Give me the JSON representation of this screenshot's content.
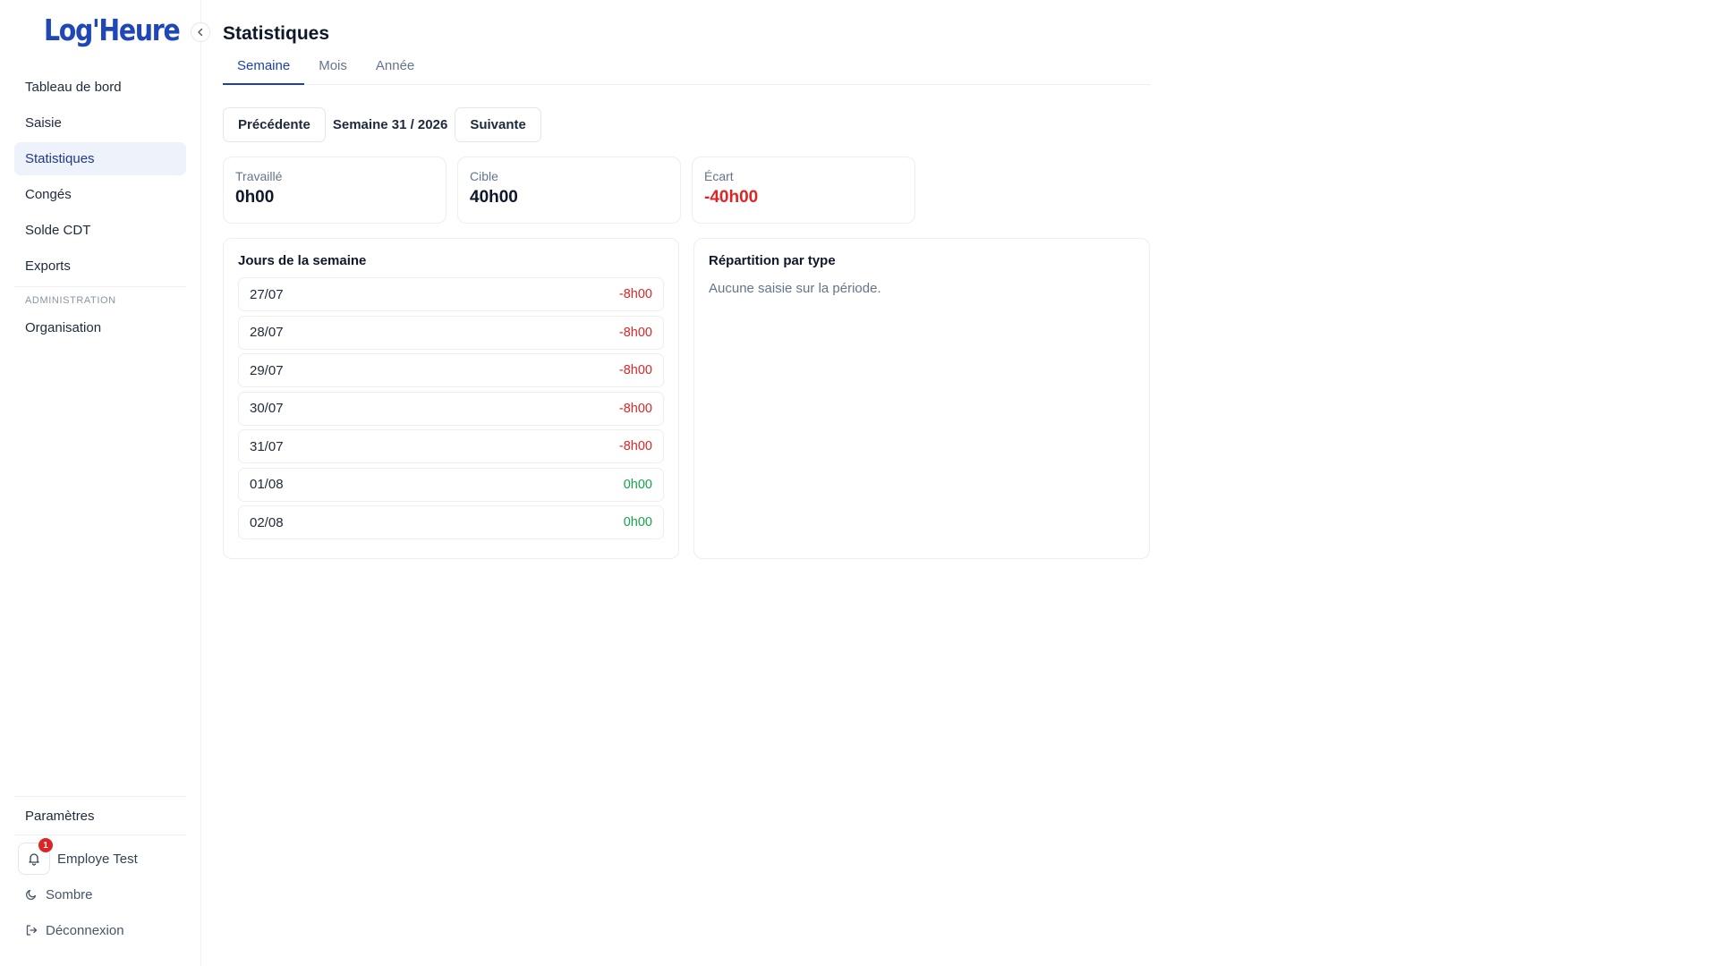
{
  "app": {
    "logo": "Log'Heure"
  },
  "sidebar": {
    "nav": [
      {
        "label": "Tableau de bord",
        "active": false
      },
      {
        "label": "Saisie",
        "active": false
      },
      {
        "label": "Statistiques",
        "active": true
      },
      {
        "label": "Congés",
        "active": false
      },
      {
        "label": "Solde CDT",
        "active": false
      },
      {
        "label": "Exports",
        "active": false
      }
    ],
    "admin_section": "ADMINISTRATION",
    "admin_nav": [
      {
        "label": "Organisation"
      }
    ],
    "settings_label": "Paramètres",
    "user": {
      "name": "Employe Test",
      "notifications": "1"
    },
    "theme_label": "Sombre",
    "logout_label": "Déconnexion"
  },
  "page": {
    "title": "Statistiques",
    "tabs": [
      {
        "label": "Semaine",
        "active": true
      },
      {
        "label": "Mois",
        "active": false
      },
      {
        "label": "Année",
        "active": false
      }
    ],
    "week_nav": {
      "prev_label": "Précédente",
      "current": "Semaine 31 / 2026",
      "next_label": "Suivante"
    },
    "stats": [
      {
        "label": "Travaillé",
        "value": "0h00",
        "negative": false
      },
      {
        "label": "Cible",
        "value": "40h00",
        "negative": false
      },
      {
        "label": "Écart",
        "value": "-40h00",
        "negative": true
      }
    ],
    "days_panel": {
      "title": "Jours de la semaine",
      "days": [
        {
          "date": "27/07",
          "value": "-8h00",
          "negative": true
        },
        {
          "date": "28/07",
          "value": "-8h00",
          "negative": true
        },
        {
          "date": "29/07",
          "value": "-8h00",
          "negative": true
        },
        {
          "date": "30/07",
          "value": "-8h00",
          "negative": true
        },
        {
          "date": "31/07",
          "value": "-8h00",
          "negative": true
        },
        {
          "date": "01/08",
          "value": "0h00",
          "negative": false
        },
        {
          "date": "02/08",
          "value": "0h00",
          "negative": false
        }
      ]
    },
    "types_panel": {
      "title": "Répartition par type",
      "empty_text": "Aucune saisie sur la période."
    }
  },
  "colors": {
    "brand": "#1f47b8",
    "accent": "#1e40af",
    "active_bg": "#eef2fb",
    "negative": "#dc2626",
    "positive": "#16a34a"
  }
}
